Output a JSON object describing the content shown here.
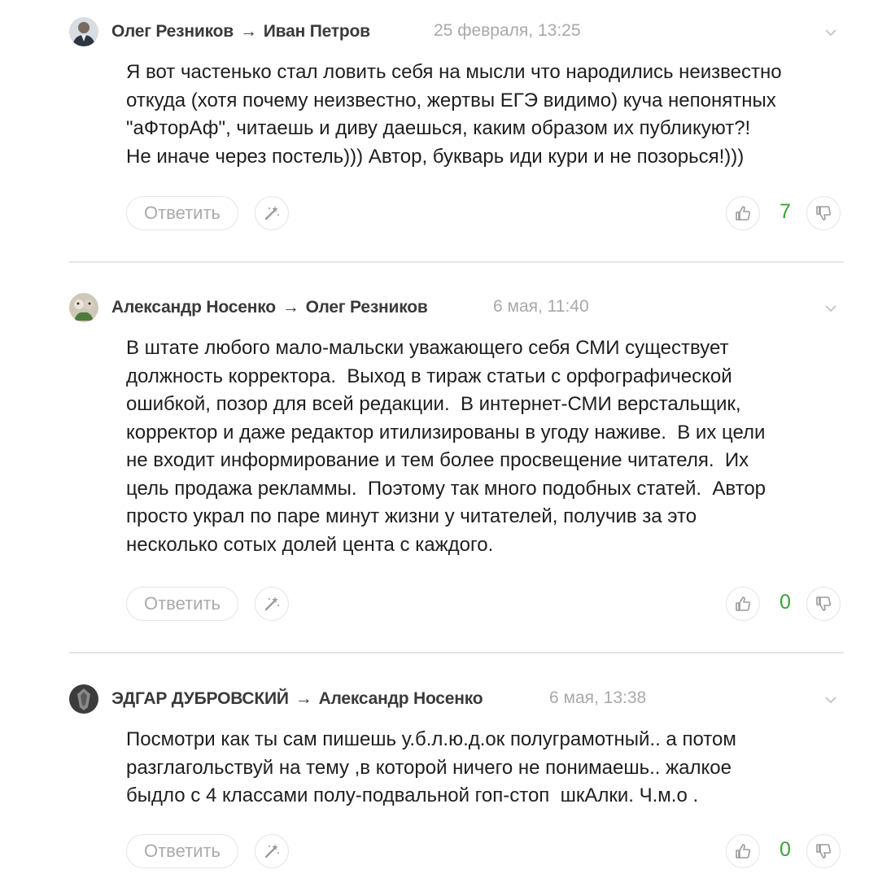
{
  "comments": [
    {
      "author": "Олег Резников",
      "reply_to": "Иван Петров",
      "arrow": "→",
      "date": "25 февраля, 13:25",
      "lines": [
        "Я вот частенько стал ловить себя на мысли что народились неизвестно",
        "откуда (хотя почему неизвестно, жертвы ЕГЭ видимо) куча непонятных",
        "\"аФторАф\", читаешь и диву даешься, каким образом их публикуют?!",
        "Не иначе через постель))) Автор, букварь иди кури и не позорься!)))"
      ],
      "reply_label": "Ответить",
      "score": "7"
    },
    {
      "author": "Александр Носенко",
      "reply_to": "Олег Резников",
      "arrow": "→",
      "date": "6 мая, 11:40",
      "lines": [
        "В штате любого мало-мальски уважающего себя СМИ существует",
        "должность корректора.  Выход в тираж статьи с орфографической",
        "ошибкой, позор для всей редакции.  В интернет-СМИ верстальщик,",
        "корректор и даже редактор итилизированы в угоду наживе.  В их цели",
        "не входит информирование и тем более просвещение читателя.  Их",
        "цель продажа рекламмы.  Поэтому так много подобных статей.  Автор",
        "просто украл по паре минут жизни у читателей, получив за это",
        "несколько сотых долей цента с каждого."
      ],
      "reply_label": "Ответить",
      "score": "0"
    },
    {
      "author": "ЭДГАР ДУБРОВСКИЙ",
      "reply_to": "Александр Носенко",
      "arrow": "→",
      "date": "6 мая, 13:38",
      "lines": [
        "Посмотри как ты сам пишешь у.б.л.ю.д.ок полуграмотный.. а потом",
        "разглагольствуй на тему ,в которой ничего не понимаешь.. жалкое",
        "быдло с 4 классами полу-подвальной гоп-стоп  шкАлки. Ч.м.о ."
      ],
      "reply_label": "Ответить",
      "score": "0"
    }
  ],
  "colors": {
    "score": "#3aa33a",
    "date": "#a9a9a9",
    "border": "#e4e4e4"
  },
  "icons": [
    "magic-wand-icon",
    "thumbs-up-icon",
    "thumbs-down-icon",
    "chevron-down-icon"
  ]
}
